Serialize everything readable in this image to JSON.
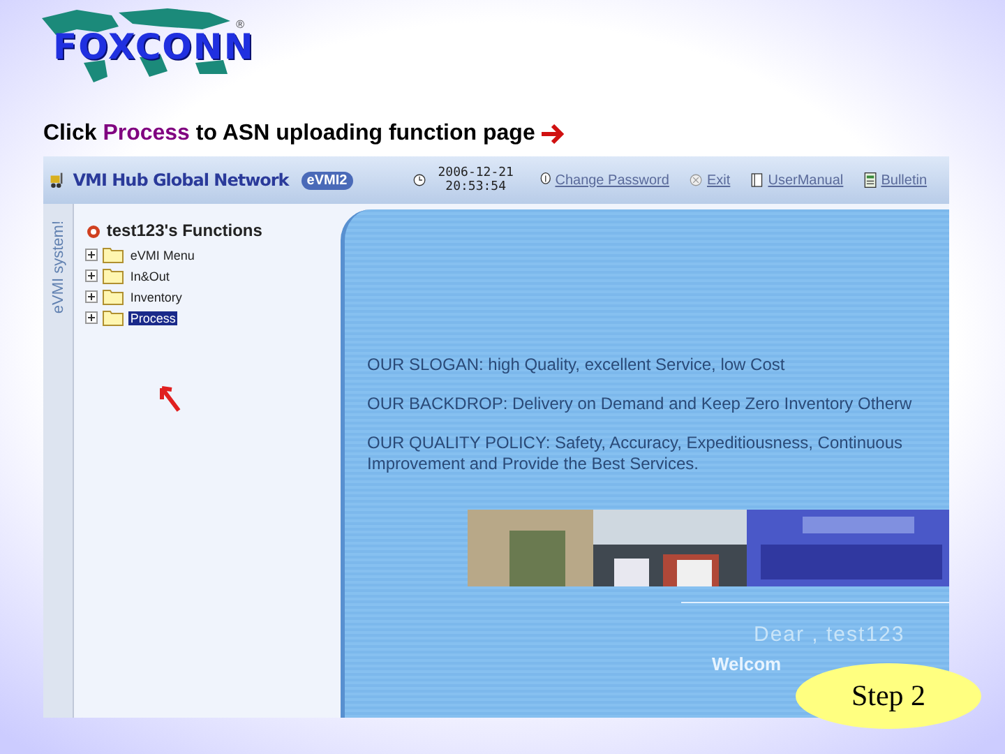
{
  "logo": {
    "text": "FOXCONN",
    "mark": "®"
  },
  "heading": [
    {
      "kind": "plain",
      "text": "Click "
    },
    {
      "kind": "highlight",
      "text": "Process"
    },
    {
      "kind": "plain",
      "text": " to ASN uploading function page"
    }
  ],
  "app": {
    "brand": "VMI Hub Global Network",
    "badge": "eVMI2",
    "date": "2006-12-21",
    "time": "20:53:54",
    "links": [
      {
        "kind": "key",
        "label": "Change Password"
      },
      {
        "kind": "exit",
        "label": "Exit"
      },
      {
        "kind": "book",
        "label": "UserManual"
      },
      {
        "kind": "bulletin",
        "label": "Bulletin"
      }
    ],
    "side_label": "eVMI system!",
    "tree": {
      "title": "test123's Functions",
      "items": [
        {
          "label": "eVMI Menu",
          "expanded": false,
          "selected": false
        },
        {
          "label": "In&Out",
          "expanded": false,
          "selected": false
        },
        {
          "label": "Inventory",
          "expanded": false,
          "selected": false
        },
        {
          "label": "Process",
          "expanded": false,
          "selected": true
        }
      ]
    },
    "slogans": [
      "OUR SLOGAN: high Quality, excellent Service, low Cost",
      "OUR BACKDROP: Delivery on Demand and Keep Zero Inventory Otherw",
      "OUR QUALITY POLICY: Safety, Accuracy, Expeditiousness, Continuous Improvement and Provide the Best Services."
    ],
    "banner": {
      "kind": "picture"
    },
    "greeting": "Dear , test123",
    "welcome": "Welcom"
  },
  "step": "Step 2"
}
